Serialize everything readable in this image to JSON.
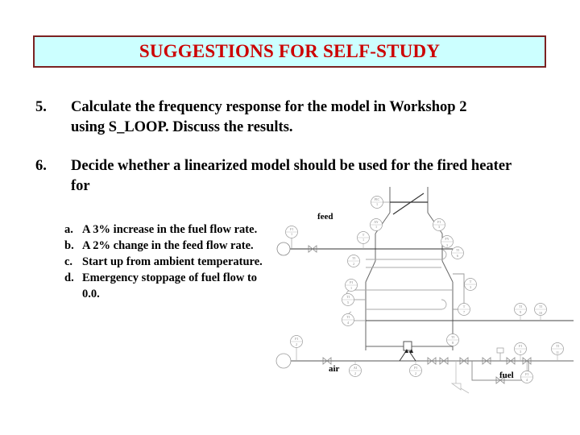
{
  "slide": {
    "title": "SUGGESTIONS FOR SELF-STUDY",
    "title_color": "#cc0000",
    "title_bg": "#ccffff",
    "title_border": "#7b2222",
    "background": "#ffffff"
  },
  "items": [
    {
      "marker": "5.",
      "text": "Calculate the frequency response for the model in Workshop 2 using S_LOOP.  Discuss the results."
    },
    {
      "marker": "6.",
      "text": "Decide whether a linearized model should be used for the fired heater for"
    }
  ],
  "subitems": [
    {
      "marker": "a.",
      "text": "A 3% increase in the fuel flow rate."
    },
    {
      "marker": "b.",
      "text": "A 2% change in the feed flow rate."
    },
    {
      "marker": "c.",
      "text": "Start up from ambient temperature."
    },
    {
      "marker": "d.",
      "text": "Emergency stoppage of fuel flow to 0.0."
    }
  ],
  "diagram": {
    "name": "fired-heater-pid",
    "line_color": "#808080",
    "dark_line_color": "#333333",
    "stream_labels": {
      "feed": "feed",
      "air": "air",
      "fuel": "fuel"
    },
    "instruments": [
      {
        "tag": "PIC",
        "num": "1"
      },
      {
        "tag": "AY",
        "num": "1"
      },
      {
        "tag": "FI",
        "num": "3"
      },
      {
        "tag": "FI",
        "num": "1"
      },
      {
        "tag": "T",
        "num": "1"
      },
      {
        "tag": "TI",
        "num": "2"
      },
      {
        "tag": "FY",
        "num": "3"
      },
      {
        "tag": "TI",
        "num": "6"
      },
      {
        "tag": "PI",
        "num": "1"
      },
      {
        "tag": "TI",
        "num": "5"
      },
      {
        "tag": "TI",
        "num": "4"
      },
      {
        "tag": "T",
        "num": "3"
      },
      {
        "tag": "T",
        "num": "7"
      },
      {
        "tag": "T",
        "num": "8"
      },
      {
        "tag": "TI",
        "num": "9"
      },
      {
        "tag": "TI",
        "num": "10"
      },
      {
        "tag": "FI",
        "num": "2"
      },
      {
        "tag": "AI",
        "num": "2"
      },
      {
        "tag": "PI",
        "num": "2"
      },
      {
        "tag": "TI",
        "num": "8"
      },
      {
        "tag": "FI",
        "num": "4"
      },
      {
        "tag": "FI",
        "num": "3"
      },
      {
        "tag": "TI",
        "num": "11"
      }
    ]
  }
}
